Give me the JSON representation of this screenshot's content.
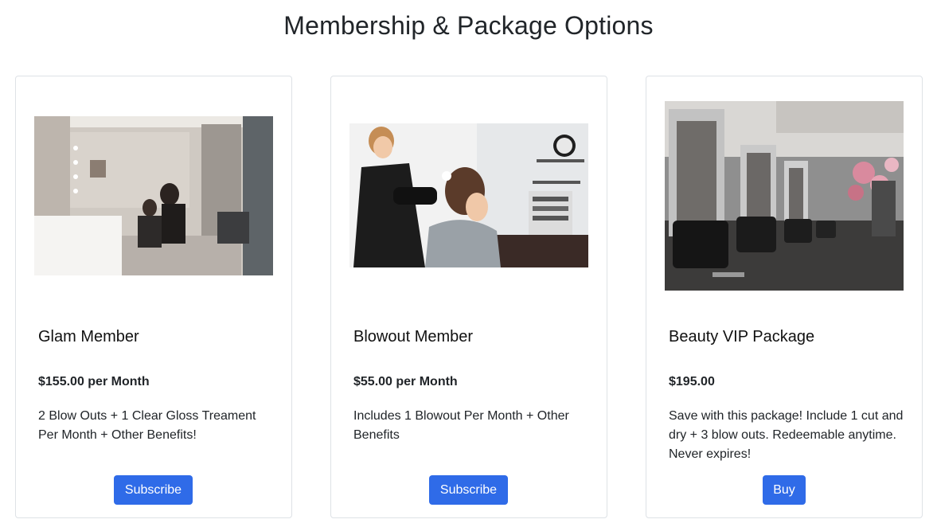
{
  "page": {
    "title": "Membership & Package Options"
  },
  "cards": [
    {
      "image": "salon-interior-photo",
      "title": "Glam Member",
      "price": "$155.00 per Month",
      "description": "2 Blow Outs + 1 Clear Gloss Treament Per Month + Other Benefits!",
      "button_label": "Subscribe"
    },
    {
      "image": "stylist-blowdrying-photo",
      "title": "Blowout Member",
      "price": "$55.00 per Month",
      "description": "Includes 1 Blowout Per Month + Other Benefits",
      "button_label": "Subscribe"
    },
    {
      "image": "salon-chairs-mirrors-photo",
      "title": "Beauty VIP Package",
      "price": "$195.00",
      "description": "Save with this package! Include 1 cut and dry + 3 blow outs. Redeemable anytime. Never expires!",
      "button_label": "Buy"
    }
  ],
  "colors": {
    "button": "#2f6be8",
    "border": "#dee2e6",
    "text": "#212529"
  }
}
